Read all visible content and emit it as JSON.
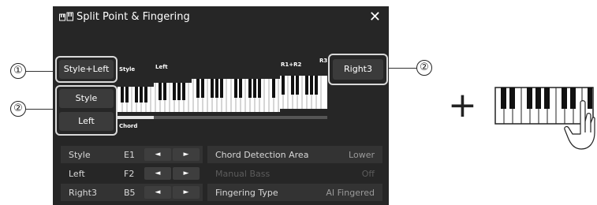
{
  "title": "Split Point & Fingering",
  "buttons": {
    "style_left": "Style+Left",
    "style": "Style",
    "left": "Left",
    "right3": "Right3"
  },
  "keyboard_labels": {
    "style": "Style",
    "left": "Left",
    "r1r2": "R1+R2",
    "r3": "R3",
    "chord": "Chord"
  },
  "split_rows": [
    {
      "part": "Style",
      "note": "E1",
      "dec": "◄",
      "inc": "►"
    },
    {
      "part": "Left",
      "note": "F2",
      "dec": "◄",
      "inc": "►"
    },
    {
      "part": "Right3",
      "note": "B5",
      "dec": "◄",
      "inc": "►"
    }
  ],
  "settings_rows": [
    {
      "label": "Chord Detection Area",
      "value": "Lower",
      "enabled": true
    },
    {
      "label": "Manual Bass",
      "value": "Off",
      "enabled": false
    },
    {
      "label": "Fingering Type",
      "value": "AI Fingered",
      "enabled": true
    }
  ],
  "callouts": [
    "①",
    "②",
    "②"
  ],
  "plus": "+",
  "colors": {
    "panel": "#262626",
    "button": "#3b3b3b",
    "row_alt": "#333333"
  }
}
